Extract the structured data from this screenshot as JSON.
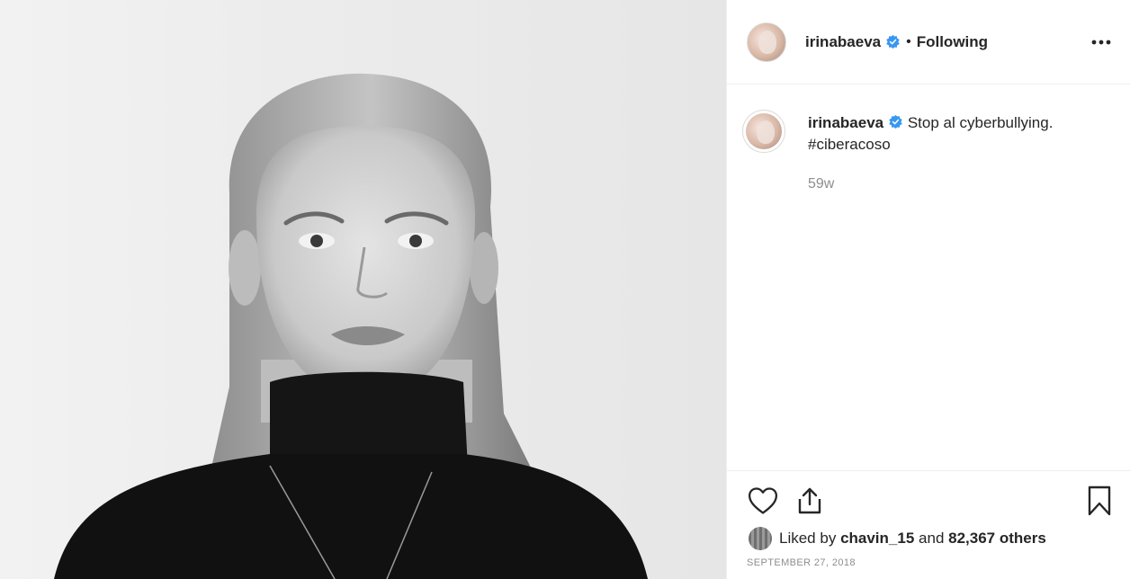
{
  "post": {
    "image_alt": "Black and white portrait of a woman in a black turtleneck",
    "author": {
      "username": "irinabaeva",
      "verified_icon": "verified-badge-icon",
      "separator": "•",
      "follow_status": "Following"
    },
    "caption": {
      "username": "irinabaeva",
      "text": "Stop al cyberbullying.",
      "hashtag": "#ciberacoso",
      "age": "59w"
    },
    "actions": {
      "like_icon": "heart-icon",
      "share_icon": "share-icon",
      "save_icon": "bookmark-icon"
    },
    "likes": {
      "prefix": "Liked by",
      "user": "chavin_15",
      "conjunction": "and",
      "others": "82,367 others"
    },
    "date": "SEPTEMBER 27, 2018"
  },
  "colors": {
    "verified": "#3897f0",
    "text": "#262626",
    "muted": "#8e8e8e",
    "border": "#efefef"
  }
}
